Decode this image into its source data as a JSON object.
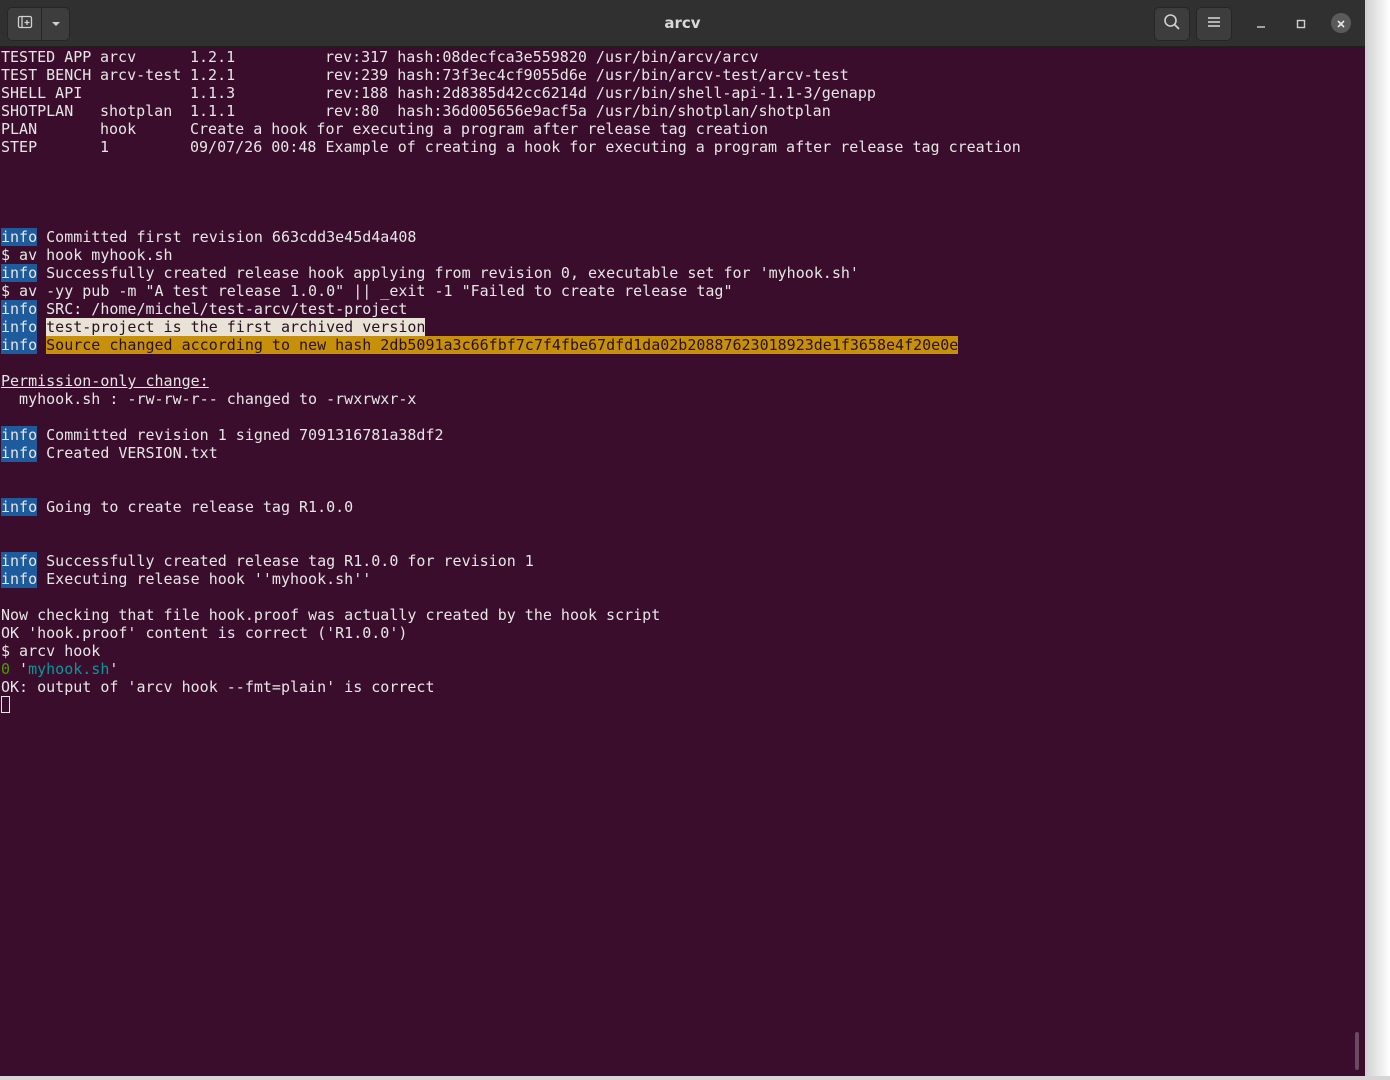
{
  "window": {
    "title": "arcv",
    "icons": [
      "new-tab-icon",
      "chevron-down-icon",
      "search-icon",
      "hamburger-menu-icon",
      "minimize-icon",
      "maximize-icon",
      "close-icon"
    ]
  },
  "colors": {
    "terminal_bg": "#3a0d2c",
    "info_badge": "#1e5b9c",
    "highlight_light": "#e8e3d6",
    "highlight_amber": "#c6900a",
    "green": "#4e9a06",
    "teal": "#06989a"
  },
  "header_table": [
    {
      "c1": "TESTED APP",
      "c2": "arcv",
      "c3": "1.2.1",
      "c4": "rev:317 hash:08decfca3e559820 /usr/bin/arcv/arcv"
    },
    {
      "c1": "TEST BENCH",
      "c2": "arcv-test",
      "c3": "1.2.1",
      "c4": "rev:239 hash:73f3ec4cf9055d6e /usr/bin/arcv-test/arcv-test"
    },
    {
      "c1": "SHELL API",
      "c2": "",
      "c3": "1.1.3",
      "c4": "rev:188 hash:2d8385d42cc6214d /usr/bin/shell-api-1.1-3/genapp"
    },
    {
      "c1": "SHOTPLAN",
      "c2": "shotplan",
      "c3": "1.1.1",
      "c4": "rev:80  hash:36d005656e9acf5a /usr/bin/shotplan/shotplan"
    },
    {
      "c1": "PLAN",
      "c2": "hook",
      "c3": "Create a hook for executing a program after release tag creation",
      "c4": ""
    },
    {
      "c1": "STEP",
      "c2": "1",
      "c3": "09/07/26 00:48",
      "c4": "Example of creating a hook for executing a program after release tag creation"
    }
  ],
  "output": {
    "info_label": "info",
    "l1": " Committed first revision 663cdd3e45d4a408",
    "l2": "$ av hook myhook.sh",
    "l3": " Successfully created release hook applying from revision 0, executable set for 'myhook.sh'",
    "l4": "$ av -yy pub -m \"A test release 1.0.0\" || _exit -1 \"Failed to create release tag\"",
    "l5": " SRC: /home/michel/test-arcv/test-project",
    "l6_hl": "test-project is the first archived version",
    "l7_hl": "Source changed according to new hash 2db5091a3c66fbf7c7f4fbe67dfd1da02b20887623018923de1f3658e4f20e0e",
    "l8": "Permission-only change:",
    "l9": "  myhook.sh : -rw-rw-r-- changed to -rwxrwxr-x",
    "l10": " Committed revision 1 signed 7091316781a38df2",
    "l11": " Created VERSION.txt",
    "l12": " Going to create release tag R1.0.0",
    "l13": " Successfully created release tag R1.0.0 for revision 1",
    "l14": " Executing release hook ''myhook.sh''",
    "l15": "Now checking that file hook.proof was actually created by the hook script",
    "l16": "OK 'hook.proof' content is correct ('R1.0.0')",
    "l17": "$ arcv hook",
    "l18_num": "0",
    "l18_q1": " '",
    "l18_file": "myhook.sh",
    "l18_q2": "'",
    "l19": "OK: output of 'arcv hook --fmt=plain' is correct"
  }
}
